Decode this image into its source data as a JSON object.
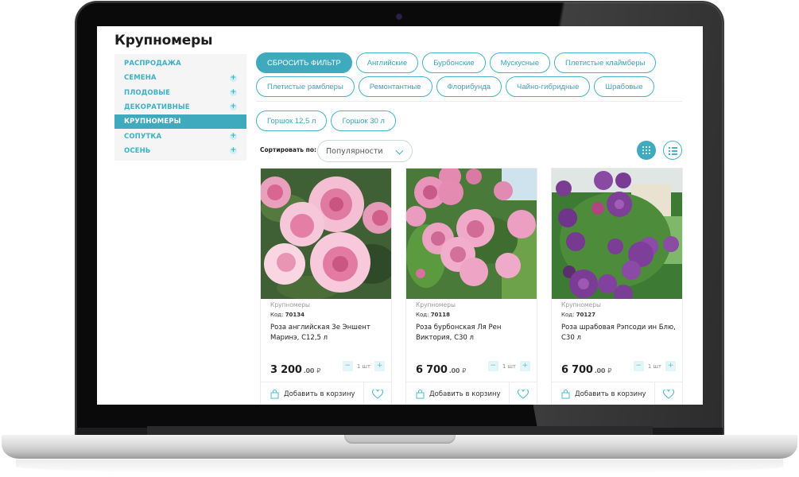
{
  "page": {
    "title": "Крупномеры"
  },
  "sidebar": {
    "items": [
      {
        "label": "РАСПРОДАЖА",
        "expandable": false,
        "active": false
      },
      {
        "label": "СЕМЕНА",
        "expandable": true,
        "active": false
      },
      {
        "label": "ПЛОДОВЫЕ",
        "expandable": true,
        "active": false
      },
      {
        "label": "ДЕКОРАТИВНЫЕ",
        "expandable": true,
        "active": false
      },
      {
        "label": "КРУПНОМЕРЫ",
        "expandable": false,
        "active": true
      },
      {
        "label": "СОПУТКА",
        "expandable": true,
        "active": false
      },
      {
        "label": "ОСЕНЬ",
        "expandable": true,
        "active": false
      }
    ],
    "expand_icon": "plus-icon"
  },
  "filters": {
    "reset_label": "СБРОСИТЬ ФИЛЬТР",
    "row1": [
      "Английские",
      "Бурбонские",
      "Мускусные",
      "Плетистые клаймберы"
    ],
    "row2": [
      "Плетистые рамблеры",
      "Ремонтантные",
      "Флорибунда",
      "Чайно-гибридные",
      "Шрабовые"
    ],
    "sizes": [
      "Горшок 12,5 л",
      "Горшок 30 л"
    ]
  },
  "sort": {
    "label": "Сортировать по:",
    "selected": "Популярности"
  },
  "view": {
    "grid_icon": "grid-view-icon",
    "list_icon": "list-view-icon",
    "active": "grid"
  },
  "products": [
    {
      "category": "Крупномеры",
      "code_label": "Код:",
      "code": "70134",
      "name": "Роза английская Зе Эншент Маринэ, С12,5 л",
      "price_main": "3 200",
      "price_cents": ".00",
      "currency": "₽",
      "qty": "1 шт",
      "add_label": "Добавить в корзину",
      "image": "pink-english-roses"
    },
    {
      "category": "Крупномеры",
      "code_label": "Код:",
      "code": "70118",
      "name": "Роза бурбонская Ля Рен Виктория, С30 л",
      "price_main": "6 700",
      "price_cents": ".00",
      "currency": "₽",
      "qty": "1 шт",
      "add_label": "Добавить в корзину",
      "image": "pink-bourbon-roses"
    },
    {
      "category": "Крупномеры",
      "code_label": "Код:",
      "code": "70127",
      "name": "Роза шрабовая Рэпсоди ин Блю, С30 л",
      "price_main": "6 700",
      "price_cents": ".00",
      "currency": "₽",
      "qty": "1 шт",
      "add_label": "Добавить в корзину",
      "image": "purple-shrub-roses"
    }
  ],
  "qty_controls": {
    "minus": "−",
    "plus": "+"
  },
  "colors": {
    "accent": "#3fa9bd",
    "accent_light": "#e4f5f8",
    "sidebar_bg": "#f5f5f6",
    "text_dark": "#1d1d1d"
  }
}
